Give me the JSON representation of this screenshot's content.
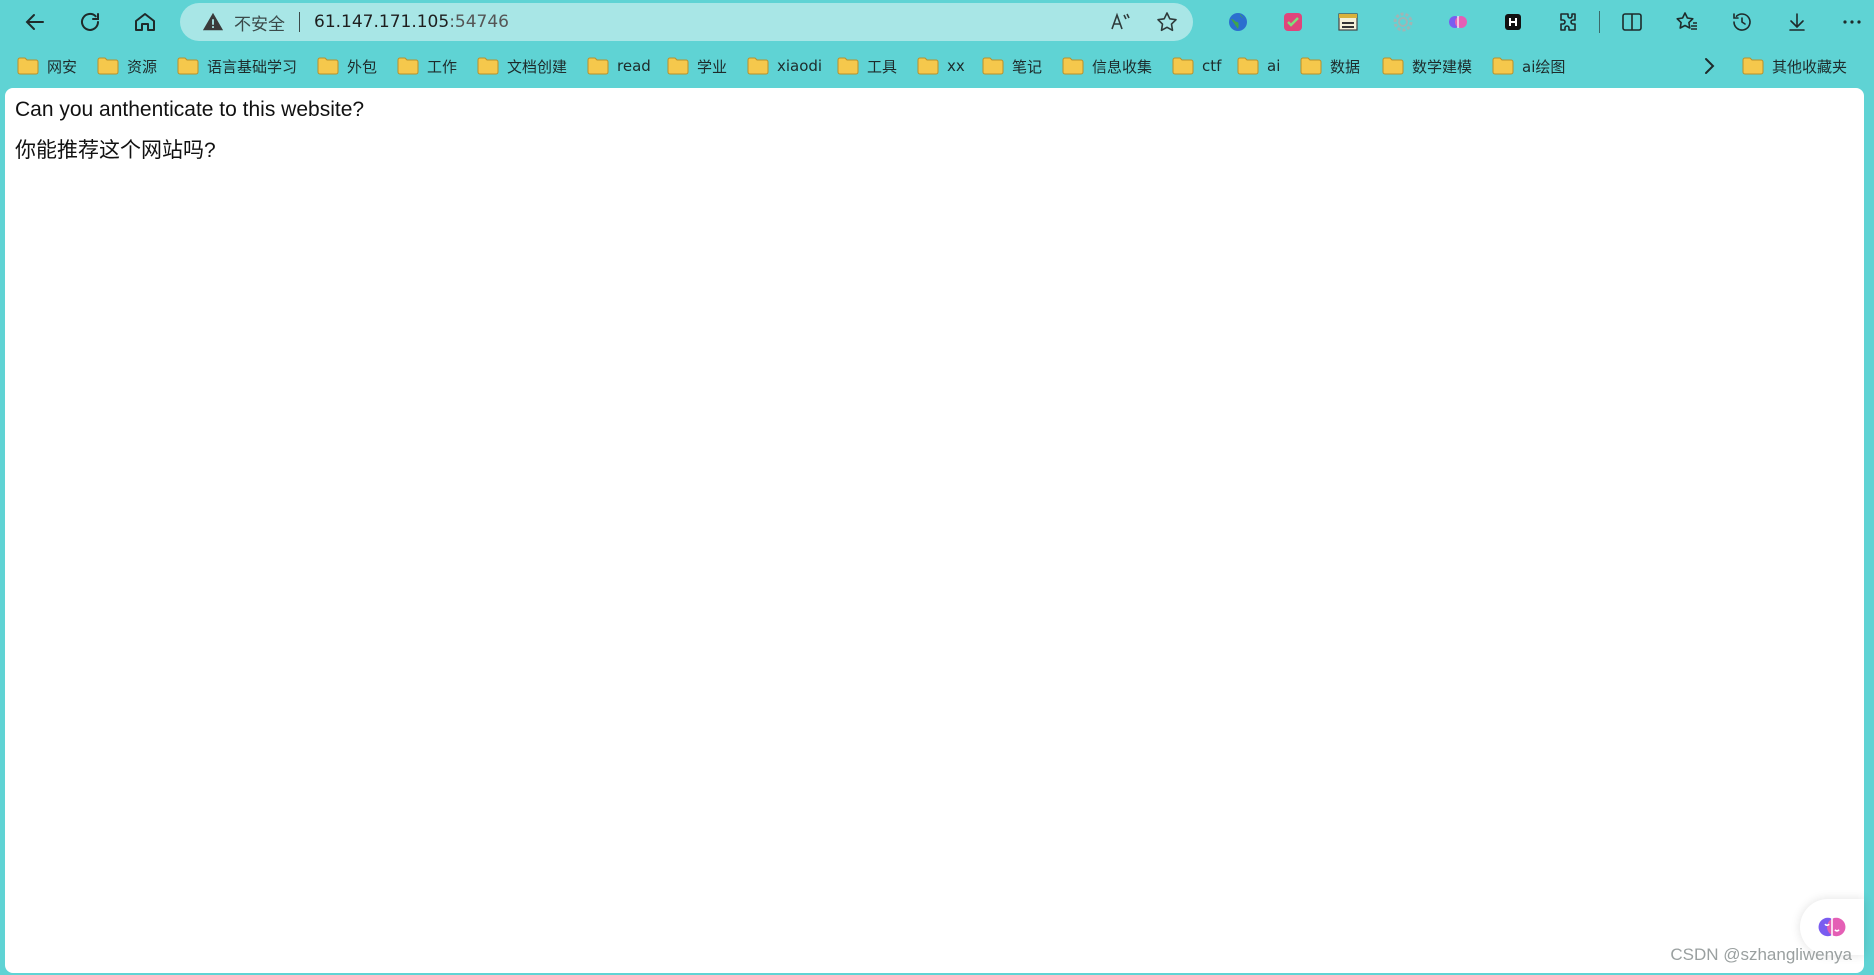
{
  "toolbar": {
    "security_label": "不安全",
    "url_host": "61.147.171.105",
    "url_port": ":54746"
  },
  "bookmarks": [
    {
      "label": "网安"
    },
    {
      "label": "资源"
    },
    {
      "label": "语言基础学习"
    },
    {
      "label": "外包"
    },
    {
      "label": "工作"
    },
    {
      "label": "文档创建"
    },
    {
      "label": "read"
    },
    {
      "label": "学业"
    },
    {
      "label": "xiaodi"
    },
    {
      "label": "工具"
    },
    {
      "label": "xx"
    },
    {
      "label": "笔记"
    },
    {
      "label": "信息收集"
    },
    {
      "label": "ctf"
    },
    {
      "label": "ai"
    },
    {
      "label": "数据"
    },
    {
      "label": "数学建模"
    },
    {
      "label": "ai绘图"
    }
  ],
  "other_bookmarks": "其他收藏夹",
  "page": {
    "line1": "Can you anthenticate to this website?",
    "line2": "你能推荐这个网站吗?"
  },
  "watermark": "CSDN @szhangliwenya",
  "colors": {
    "frame": "#5fd3d4",
    "address_bar": "#a8e6e6",
    "content_bg": "#ffffff"
  },
  "icons": [
    "back-icon",
    "refresh-icon",
    "home-icon",
    "warning-icon",
    "read-aloud-icon",
    "favorite-star-icon",
    "extension-globe-icon",
    "extension-pink-icon",
    "extension-notes-icon",
    "extension-gear-icon",
    "extension-brain-icon",
    "extension-h-icon",
    "extensions-puzzle-icon",
    "split-screen-icon",
    "favorites-icon",
    "history-icon",
    "download-icon",
    "more-icon",
    "folder-icon",
    "chevron-right-icon",
    "brain-fab-icon"
  ]
}
